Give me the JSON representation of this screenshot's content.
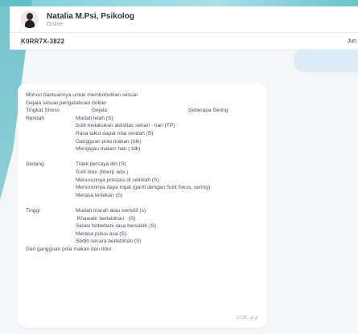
{
  "header": {
    "name": "Natalia M.Psi, Psikolog",
    "status": "Online"
  },
  "subheader": {
    "ticket": "K0RR7X-3822",
    "date": "Jun"
  },
  "message": {
    "intro1": "Mohon bantuannya untuk membobotkan sesuai",
    "intro2": "Gejala sesuai pengetahuan dokter",
    "col_headers": [
      "Tingkat Stress",
      "Gejala",
      "Seberapa Sering"
    ],
    "rendah_label": "Rendah",
    "rendah_items": [
      "Mudah lelah  (S)",
      "Sulit melakukan aktivitas sehari - hari        (TP)",
      "Rasa takut dapat nilai rendah     (S)",
      "Gangguan pola makan (tdk)",
      "Mengigau malam hari ( tdk)"
    ],
    "sedang_label": "Sedang",
    "sedang_items": [
      "Tidak percaya diri (S)",
      "Sulit tidur      (bberp ada )",
      "Menurunnya prestasi di sekolah (S)",
      "Menurunnya daya ingat      (ganti dengan Sulit fokus, sering)",
      "Merasa tertekan (S)"
    ],
    "tinggi_label": "Tinggi",
    "tinggi_items": [
      "Mudah marah atau sensitif  (s)",
      " Khawatir berlebihan   (S)",
      "Selalu terbebani rasa bersalah   (S)",
      "Merasa putus asa  (S)",
      "Sedih secara berlebihan (S)"
    ],
    "closing": "Dan gangguan pola makan dan tidur",
    "time": "13:36",
    "read_icon": "double-check-icon"
  }
}
